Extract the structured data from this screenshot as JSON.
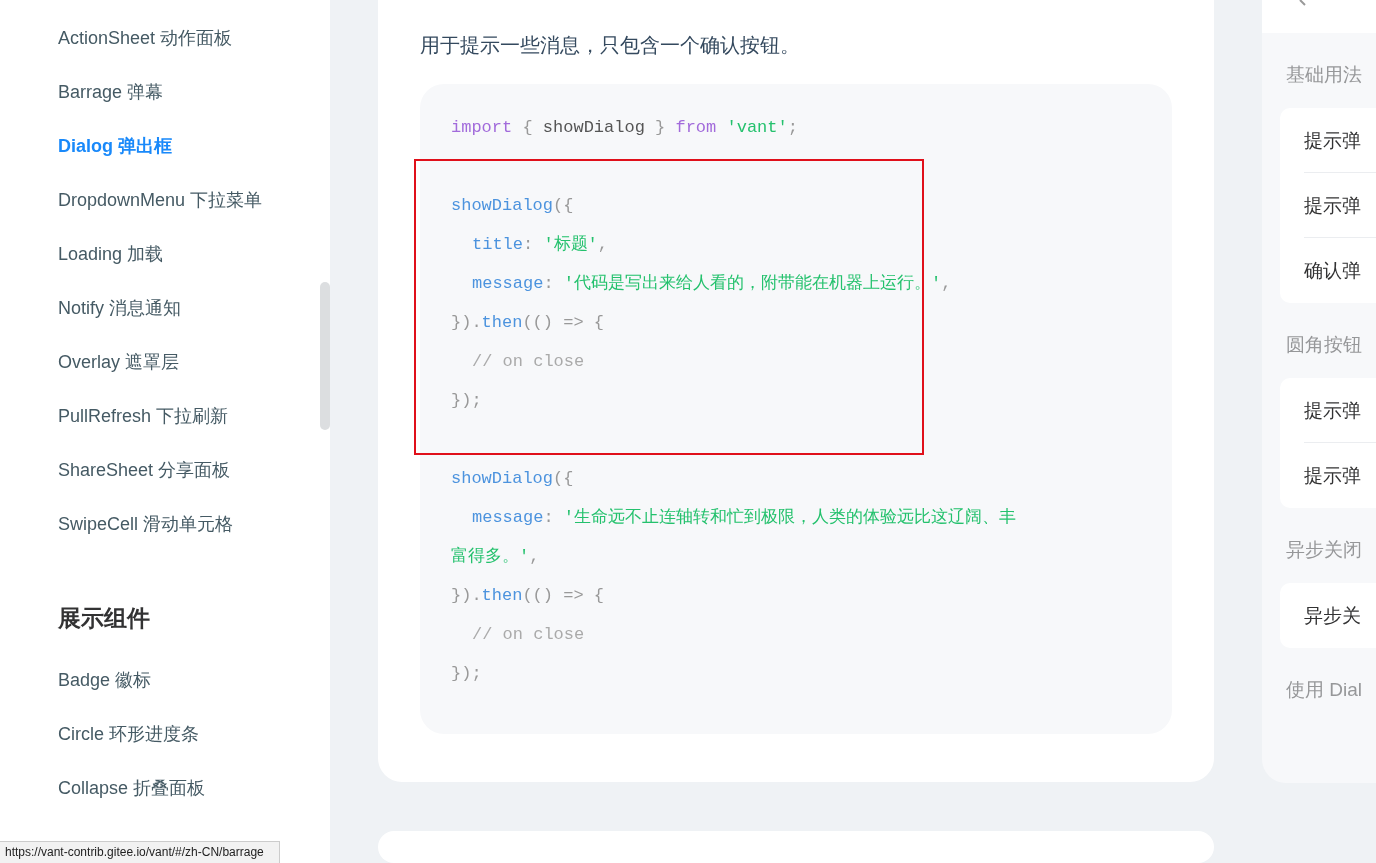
{
  "sidebar": {
    "items": [
      {
        "label": "ActionSheet 动作面板",
        "selected": false
      },
      {
        "label": "Barrage 弹幕",
        "selected": false
      },
      {
        "label": "Dialog 弹出框",
        "selected": true
      },
      {
        "label": "DropdownMenu 下拉菜单",
        "selected": false
      },
      {
        "label": "Loading 加载",
        "selected": false
      },
      {
        "label": "Notify 消息通知",
        "selected": false
      },
      {
        "label": "Overlay 遮罩层",
        "selected": false
      },
      {
        "label": "PullRefresh 下拉刷新",
        "selected": false
      },
      {
        "label": "ShareSheet 分享面板",
        "selected": false
      },
      {
        "label": "SwipeCell 滑动单元格",
        "selected": false
      }
    ],
    "group": {
      "title": "展示组件",
      "items": [
        {
          "label": "Badge 徽标",
          "selected": false
        },
        {
          "label": "Circle 环形进度条",
          "selected": false
        },
        {
          "label": "Collapse 折叠面板",
          "selected": false
        }
      ]
    }
  },
  "doc": {
    "intro": "用于提示一些消息，只包含一个确认按钮。",
    "code_blocks": [
      [
        {
          "indent": false,
          "tokens": [
            {
              "text": "import",
              "kind": "keyword"
            },
            {
              "text": " { ",
              "kind": "punct"
            },
            {
              "text": "showDialog",
              "kind": "plain"
            },
            {
              "text": " } ",
              "kind": "punct"
            },
            {
              "text": "from",
              "kind": "keyword"
            },
            {
              "text": " 'vant'",
              "kind": "string"
            },
            {
              "text": ";",
              "kind": "punct"
            }
          ]
        }
      ],
      [
        {
          "indent": false,
          "tokens": [
            {
              "text": "showDialog",
              "kind": "fn"
            },
            {
              "text": "({",
              "kind": "punct"
            }
          ]
        },
        {
          "indent": true,
          "tokens": [
            {
              "text": "title",
              "kind": "fn"
            },
            {
              "text": ": ",
              "kind": "punct"
            },
            {
              "text": "'标题'",
              "kind": "string"
            },
            {
              "text": ",",
              "kind": "punct"
            }
          ]
        },
        {
          "indent": true,
          "tokens": [
            {
              "text": "message",
              "kind": "fn"
            },
            {
              "text": ": ",
              "kind": "punct"
            },
            {
              "text": "'代码是写出来给人看的，附带能在机器上运行。'",
              "kind": "string"
            },
            {
              "text": ",",
              "kind": "punct"
            }
          ]
        },
        {
          "indent": false,
          "tokens": [
            {
              "text": "}).",
              "kind": "punct"
            },
            {
              "text": "then",
              "kind": "fn"
            },
            {
              "text": "(() => {",
              "kind": "punct"
            }
          ]
        },
        {
          "indent": true,
          "tokens": [
            {
              "text": "// on close",
              "kind": "comment"
            }
          ]
        },
        {
          "indent": false,
          "tokens": [
            {
              "text": "});",
              "kind": "punct"
            }
          ]
        }
      ],
      [
        {
          "indent": false,
          "tokens": [
            {
              "text": "showDialog",
              "kind": "fn"
            },
            {
              "text": "({",
              "kind": "punct"
            }
          ]
        },
        {
          "indent": true,
          "tokens": [
            {
              "text": "message",
              "kind": "fn"
            },
            {
              "text": ": ",
              "kind": "punct"
            },
            {
              "text": "'生命远不止连轴转和忙到极限，人类的体验远比这辽阔、丰富得多。'",
              "kind": "string"
            },
            {
              "text": ",",
              "kind": "punct"
            }
          ]
        },
        {
          "indent": false,
          "tokens": [
            {
              "text": "}).",
              "kind": "punct"
            },
            {
              "text": "then",
              "kind": "fn"
            },
            {
              "text": "(() => {",
              "kind": "punct"
            }
          ]
        },
        {
          "indent": true,
          "tokens": [
            {
              "text": "// on close",
              "kind": "comment"
            }
          ]
        },
        {
          "indent": false,
          "tokens": [
            {
              "text": "});",
              "kind": "punct"
            }
          ]
        }
      ]
    ]
  },
  "demo_panel": {
    "sections": [
      {
        "title": "基础用法",
        "buttons": [
          "提示弹",
          "提示弹",
          "确认弹"
        ]
      },
      {
        "title": "圆角按钮",
        "buttons": [
          "提示弹",
          "提示弹"
        ]
      },
      {
        "title": "异步关闭",
        "buttons": [
          "异步关"
        ]
      },
      {
        "title": "使用 Dial"
      }
    ]
  },
  "status_bar": {
    "url": "https://vant-contrib.gitee.io/vant/#/zh-CN/barrage"
  }
}
